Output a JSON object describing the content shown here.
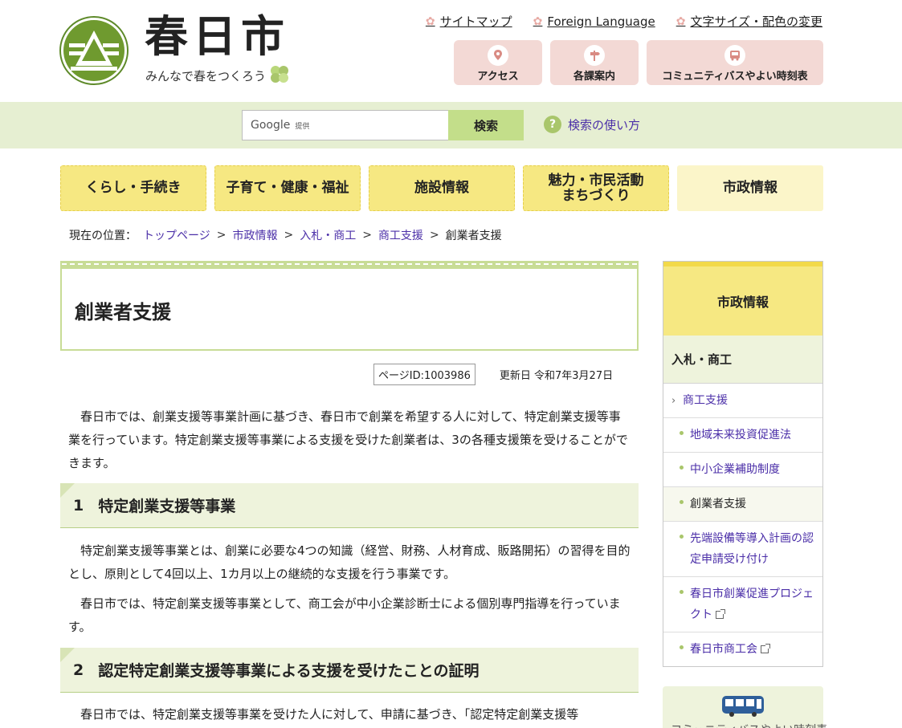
{
  "header": {
    "title": "春日市",
    "tagline": "みんなで春をつくろう",
    "util_links": [
      "サイトマップ",
      "Foreign Language",
      "文字サイズ・配色の変更"
    ],
    "quick_buttons": [
      {
        "label": "アクセス",
        "icon": "map-pin-icon"
      },
      {
        "label": "各課案内",
        "icon": "signpost-icon"
      },
      {
        "label": "コミュニティバスやよい時刻表",
        "icon": "bus-icon"
      }
    ]
  },
  "search": {
    "google_label": "Google",
    "provided_label": "提供",
    "button": "検索",
    "help_link": "検索の使い方"
  },
  "gnav": [
    "くらし・手続き",
    "子育て・健康・福祉",
    "施設情報",
    "魅力・市民活動\nまちづくり",
    "市政情報"
  ],
  "breadcrumb": {
    "label": "現在の位置：",
    "links": [
      "トップページ",
      "市政情報",
      "入札・商工",
      "商工支援"
    ],
    "current": "創業者支援"
  },
  "main": {
    "title": "創業者支援",
    "page_id": "ページID:1003986",
    "updated": "更新日 令和7年3月27日",
    "intro": "春日市では、創業支援等事業計画に基づき、春日市で創業を希望する人に対して、特定創業支援等事業を行っています。特定創業支援等事業による支援を受けた創業者は、3の各種支援策を受けることができます。",
    "sections": [
      {
        "num": "1",
        "heading": "特定創業支援等事業",
        "paras": [
          "特定創業支援等事業とは、創業に必要な4つの知識（経営、財務、人材育成、販路開拓）の習得を目的とし、原則として4回以上、1カ月以上の継続的な支援を行う事業です。",
          "春日市では、特定創業支援等事業として、商工会が中小企業診断士による個別専門指導を行っています。"
        ]
      },
      {
        "num": "2",
        "heading": "認定特定創業支援等事業による支援を受けたことの証明",
        "paras": [
          "春日市では、特定創業支援等事業を受けた人に対して、申請に基づき、「認定特定創業支援等"
        ]
      }
    ]
  },
  "sidebar": {
    "head": "市政情報",
    "sub": "入札・商工",
    "l2": "商工支援",
    "items": [
      {
        "label": "地域未来投資促進法",
        "external": false,
        "current": false
      },
      {
        "label": "中小企業補助制度",
        "external": false,
        "current": false
      },
      {
        "label": "創業者支援",
        "external": false,
        "current": true
      },
      {
        "label": "先端設備等導入計画の認定申請受け付け",
        "external": false,
        "current": false
      },
      {
        "label": "春日市創業促進プロジェクト",
        "external": true,
        "current": false
      },
      {
        "label": "春日市商工会",
        "external": true,
        "current": false
      }
    ],
    "bus_label": "コミュニティバスやよい時刻表"
  },
  "colors": {
    "nav_yellow": "#f6e882",
    "band_green": "#e6efd2",
    "accent_green": "#c8dc96",
    "quick_pink": "#f3d9d5",
    "link": "#4b2fa8"
  }
}
